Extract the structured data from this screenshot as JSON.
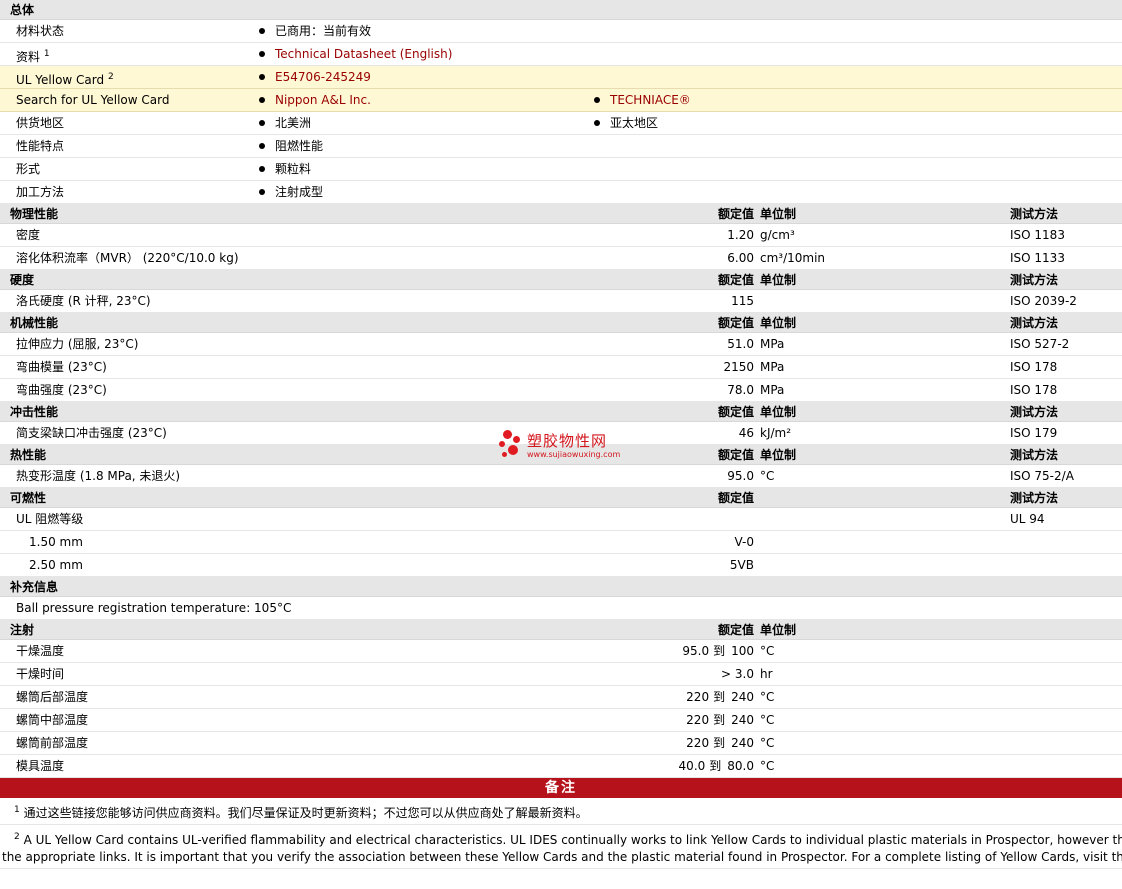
{
  "general": {
    "title": "总体",
    "rows": [
      {
        "label": "材料状态",
        "v1": "已商用：当前有效"
      },
      {
        "label": "资料",
        "sup": "1",
        "v1": "Technical Datasheet (English)",
        "link1": true
      },
      {
        "label": "UL Yellow Card",
        "sup": "2",
        "v1": "E54706-245249",
        "link1": true,
        "yellow": true
      },
      {
        "label": "Search for UL Yellow Card",
        "v1": "Nippon A&L Inc.",
        "v2": "TECHNIACE®",
        "link1": true,
        "link2": true,
        "yellow": true
      },
      {
        "label": "供货地区",
        "v1": "北美洲",
        "v2": "亚太地区"
      },
      {
        "label": "性能特点",
        "v1": "阻燃性能"
      },
      {
        "label": "形式",
        "v1": "颗粒料"
      },
      {
        "label": "加工方法",
        "v1": "注射成型"
      }
    ]
  },
  "headers": {
    "value": "额定值",
    "unit": "单位制",
    "method": "测试方法"
  },
  "physical": {
    "title": "物理性能",
    "rows": [
      {
        "label": "密度",
        "value": "1.20",
        "unit": "g/cm³",
        "method": "ISO 1183"
      },
      {
        "label": "溶化体积流率（MVR） (220°C/10.0 kg)",
        "value": "6.00",
        "unit": "cm³/10min",
        "method": "ISO 1133"
      }
    ]
  },
  "hardness": {
    "title": "硬度",
    "rows": [
      {
        "label": "洛氏硬度 (R 计秤, 23°C)",
        "value": "115",
        "unit": "",
        "method": "ISO 2039-2"
      }
    ]
  },
  "mechanical": {
    "title": "机械性能",
    "rows": [
      {
        "label": "拉伸应力 (屈服, 23°C)",
        "value": "51.0",
        "unit": "MPa",
        "method": "ISO 527-2"
      },
      {
        "label": "弯曲模量 (23°C)",
        "value": "2150",
        "unit": "MPa",
        "method": "ISO 178"
      },
      {
        "label": "弯曲强度 (23°C)",
        "value": "78.0",
        "unit": "MPa",
        "method": "ISO 178"
      }
    ]
  },
  "impact": {
    "title": "冲击性能",
    "rows": [
      {
        "label": "简支梁缺口冲击强度 (23°C)",
        "value": "46",
        "unit": "kJ/m²",
        "method": "ISO 179"
      }
    ]
  },
  "thermal": {
    "title": "热性能",
    "rows": [
      {
        "label": "热变形温度 (1.8 MPa, 未退火)",
        "value": "95.0",
        "unit": "°C",
        "method": "ISO 75-2/A"
      }
    ]
  },
  "flammability": {
    "title": "可燃性",
    "rows": [
      {
        "label": "UL 阻燃等级",
        "value": "",
        "unit": "",
        "method": "UL 94"
      },
      {
        "label": "1.50 mm",
        "value": "V-0",
        "unit": "",
        "method": "",
        "indent": true
      },
      {
        "label": "2.50 mm",
        "value": "5VB",
        "unit": "",
        "method": "",
        "indent": true
      }
    ]
  },
  "supplement": {
    "title": "补充信息",
    "text": "Ball pressure registration temperature: 105°C"
  },
  "injection": {
    "title": "注射",
    "rows": [
      {
        "label": "干燥温度",
        "from": "95.0",
        "to": "100",
        "unit": "°C"
      },
      {
        "label": "干燥时间",
        "value": "> 3.0",
        "unit": "hr"
      },
      {
        "label": "螺筒后部温度",
        "from": "220",
        "to": "240",
        "unit": "°C"
      },
      {
        "label": "螺筒中部温度",
        "from": "220",
        "to": "240",
        "unit": "°C"
      },
      {
        "label": "螺筒前部温度",
        "from": "220",
        "to": "240",
        "unit": "°C"
      },
      {
        "label": "模具温度",
        "from": "40.0",
        "to": "80.0",
        "unit": "°C"
      }
    ],
    "range_word": "到"
  },
  "notes": {
    "title": "备注",
    "n1_sup": "1",
    "n1": "通过这些链接您能够访问供应商资料。我们尽量保证及时更新资料；不过您可以从供应商处了解最新资料。",
    "n2_sup": "2",
    "n2_line1": "A UL Yellow Card contains UL-verified flammability and electrical characteristics. UL IDES continually works to link Yellow Cards to individual plastic materials in Prospector, however this list",
    "n2_line2": "the appropriate links. It is important that you verify the association between these Yellow Cards and the plastic material found in Prospector. For a complete listing of Yellow Cards, visit the UL Ye"
  },
  "watermark": {
    "name": "塑胶物性网",
    "url": "www.sujiaowuxing.com"
  },
  "colors": {
    "link": "#990000",
    "banner": "#b5121b",
    "header_bg": "#e6e6e6",
    "yellow_bg": "#fff8d5"
  }
}
